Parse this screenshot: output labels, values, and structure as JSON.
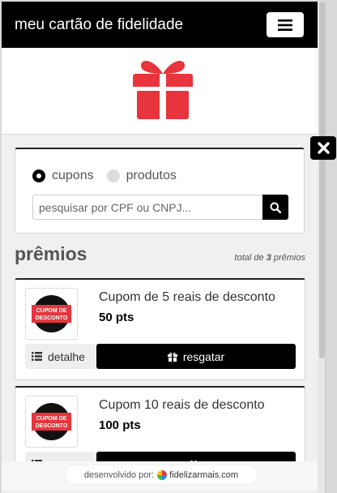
{
  "header": {
    "title": "meu cartão de fidelidade",
    "menu_icon": "hamburger-icon"
  },
  "search": {
    "options": [
      {
        "label": "cupons",
        "selected": true
      },
      {
        "label": "produtos",
        "selected": false
      }
    ],
    "placeholder": "pesquisar por CPF ou CNPJ..."
  },
  "prizes": {
    "heading": "prêmios",
    "total_prefix": "total de",
    "total_count": "3",
    "total_suffix": "prêmios",
    "items": [
      {
        "name": "Cupom de 5 reais de desconto",
        "points": "50 pts",
        "thumb_text_1": "CUPOM DE",
        "thumb_text_2": "DESCONTO",
        "detail_label": "detalhe",
        "redeem_label": "resgatar"
      },
      {
        "name": "Cupom 10 reais de desconto",
        "points": "100 pts",
        "thumb_text_1": "CUPOM DE",
        "thumb_text_2": "DESCONTO",
        "detail_label": "",
        "redeem_label": ""
      }
    ]
  },
  "footer": {
    "prefix": "desenvolvido por:",
    "brand": "fidelizarmais.com"
  },
  "colors": {
    "accent": "#000000",
    "gift": "#e8343c"
  }
}
